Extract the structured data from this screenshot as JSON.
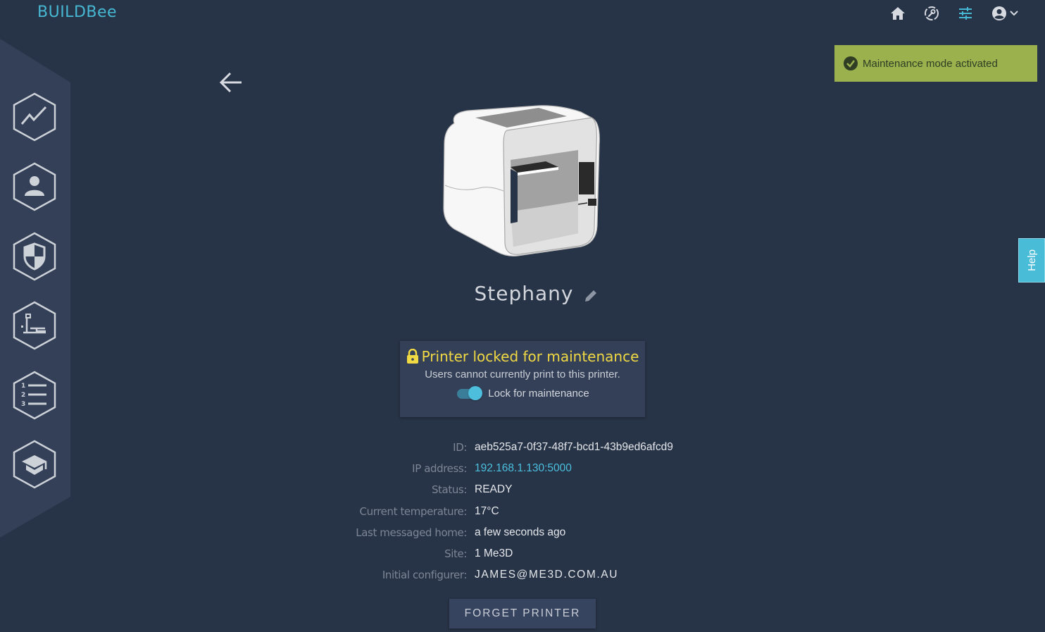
{
  "header": {
    "logo": "BUILDBee",
    "nav_icons": [
      "home-icon",
      "maintenance-clock-icon",
      "settings-sliders-icon",
      "account-circle-icon"
    ],
    "active_nav": "settings-sliders-icon",
    "colors": {
      "accent": "#47b8d3",
      "background": "#273346",
      "sidebar": "#344058"
    }
  },
  "sidebar": {
    "items": [
      {
        "icon": "analytics-chart-icon"
      },
      {
        "icon": "user-icon"
      },
      {
        "icon": "security-shield-icon"
      },
      {
        "icon": "printer-icon"
      },
      {
        "icon": "numbered-list-icon"
      },
      {
        "icon": "education-cap-icon"
      }
    ]
  },
  "toast": {
    "message": "Maintenance mode activated",
    "icon": "check-circle-icon",
    "color": "#9bb14d"
  },
  "help_tab": {
    "label": "Help"
  },
  "printer": {
    "name": "Stephany",
    "lock_panel": {
      "title": "Printer locked for maintenance",
      "subtitle": "Users cannot currently print to this printer.",
      "toggle_label": "Lock for maintenance",
      "toggle_on": true
    },
    "details": [
      {
        "label": "ID:",
        "value": "aeb525a7-0f37-48f7-bcd1-43b9ed6afcd9"
      },
      {
        "label": "IP address:",
        "value": "192.168.1.130:5000"
      },
      {
        "label": "Status:",
        "value": "READY"
      },
      {
        "label": "Current temperature:",
        "value": "17°C"
      },
      {
        "label": "Last messaged home:",
        "value": "a few seconds ago"
      },
      {
        "label": "Site:",
        "value": "1 Me3D"
      },
      {
        "label": "Initial configurer:",
        "value": "JAMES@ME3D.COM.AU"
      }
    ],
    "forget_button": "FORGET PRINTER"
  }
}
